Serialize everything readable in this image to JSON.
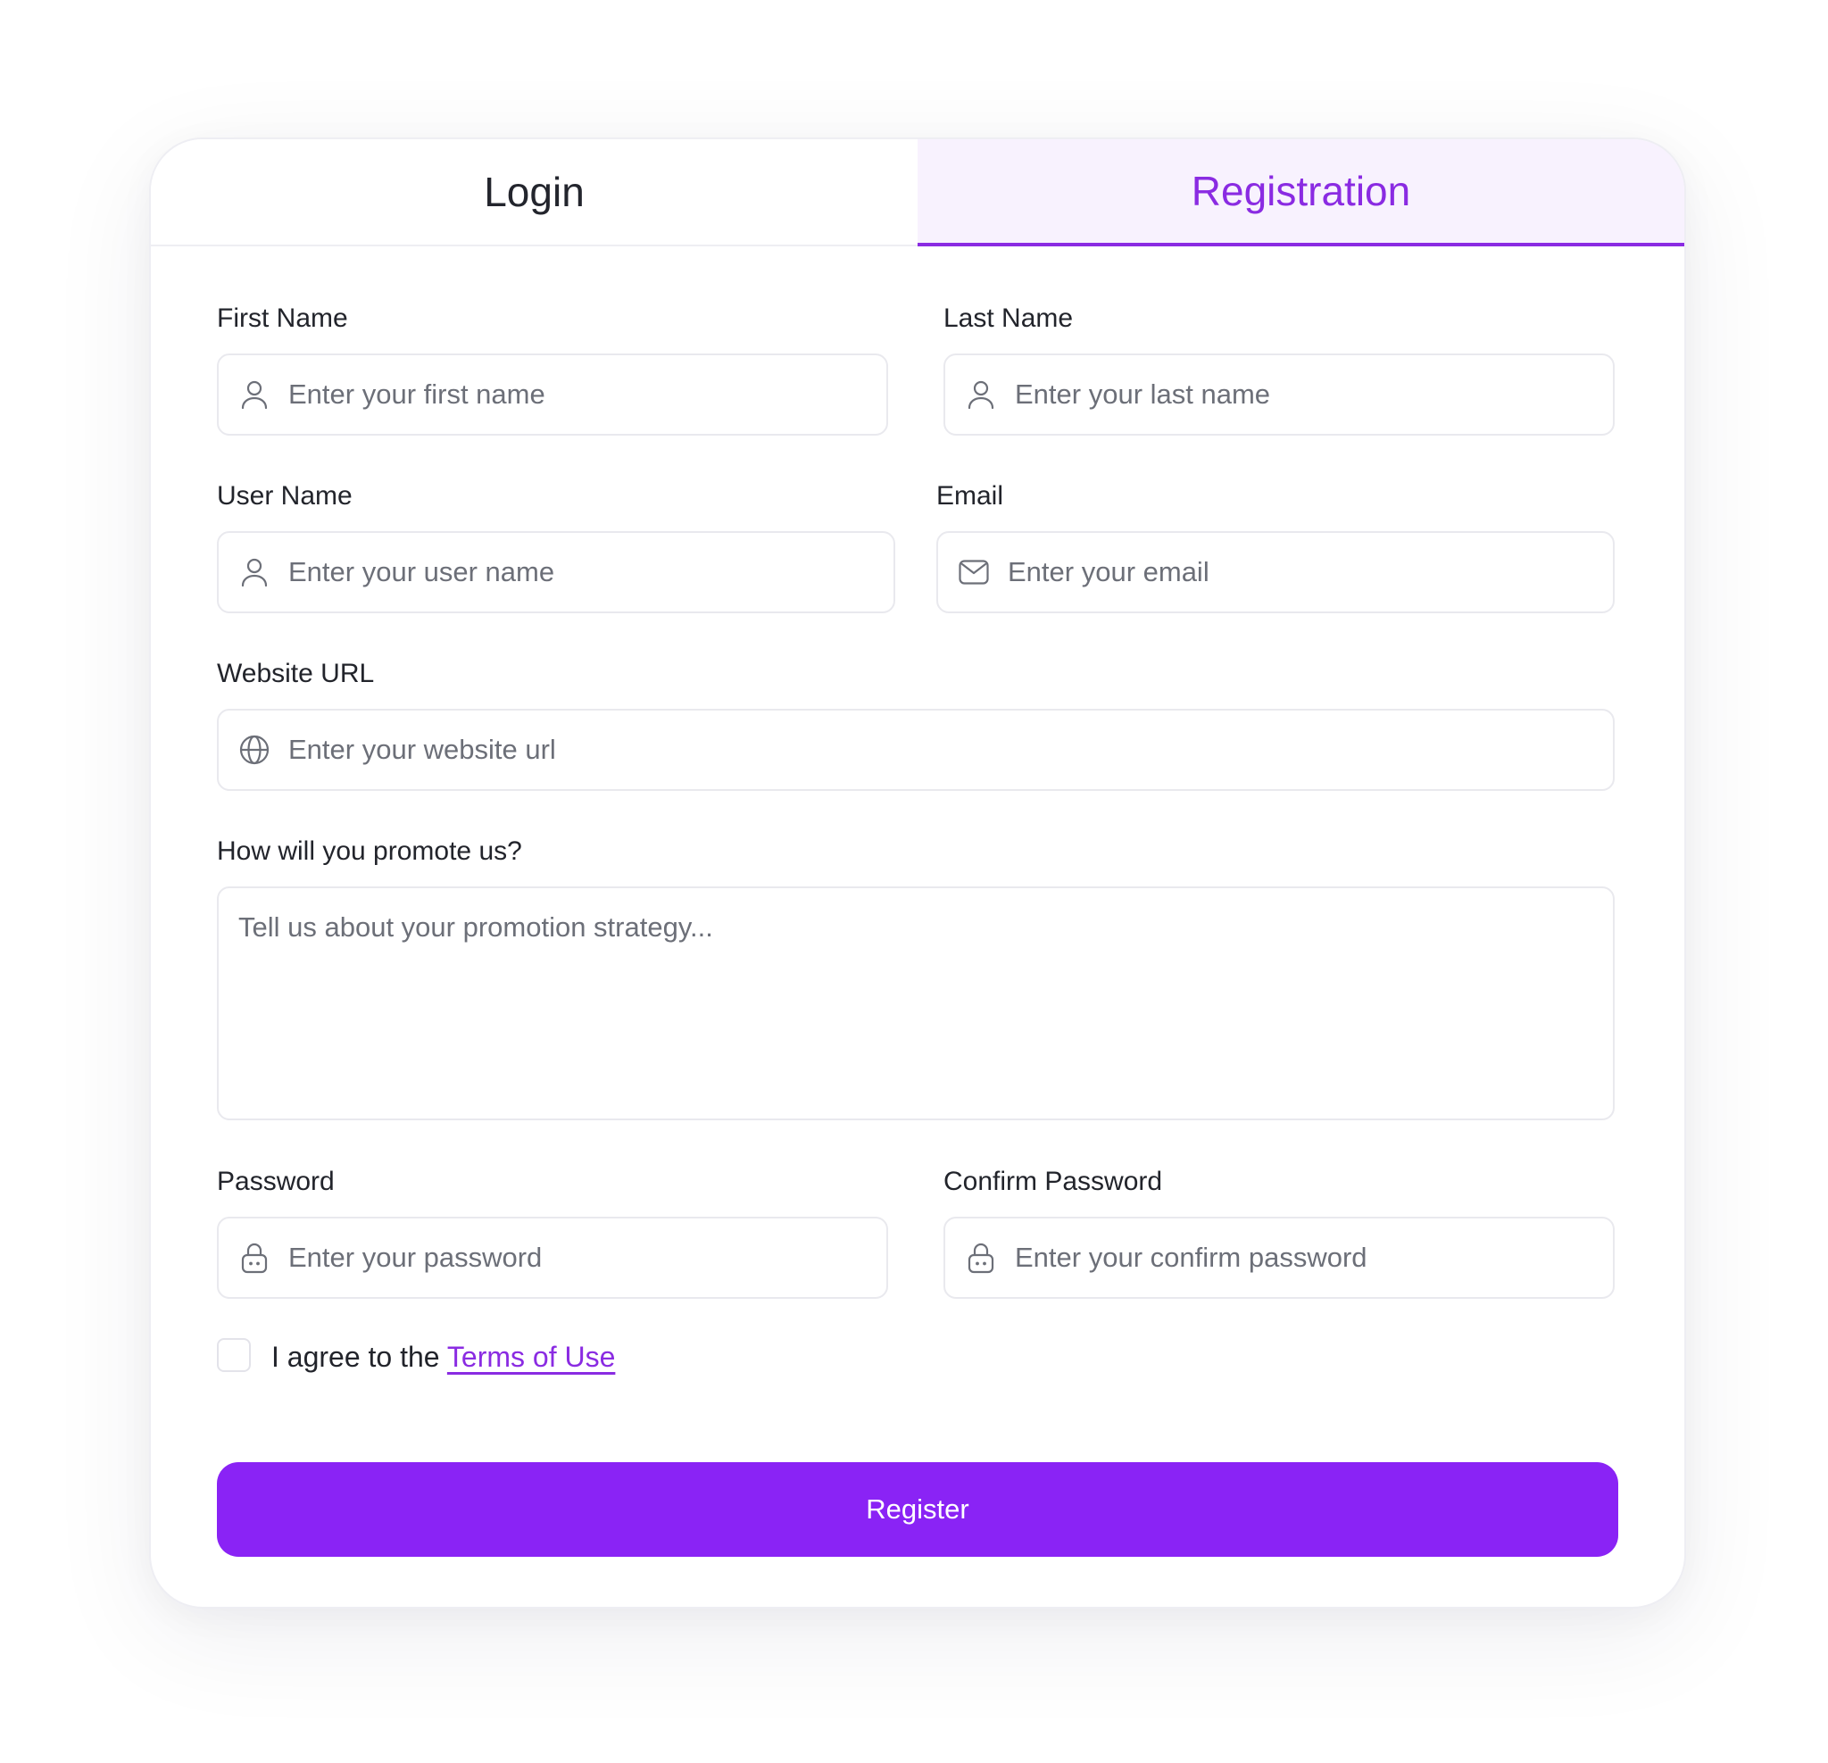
{
  "tabs": {
    "login": "Login",
    "registration": "Registration"
  },
  "form": {
    "first_name": {
      "label": "First Name",
      "placeholder": "Enter your first name"
    },
    "last_name": {
      "label": "Last Name",
      "placeholder": "Enter your last name"
    },
    "user_name": {
      "label": "User Name",
      "placeholder": "Enter your user name"
    },
    "email": {
      "label": "Email",
      "placeholder": "Enter your email"
    },
    "website": {
      "label": "Website URL",
      "placeholder": "Enter your website url"
    },
    "promotion": {
      "label": "How will you promote us?",
      "placeholder": "Tell us about your promotion strategy..."
    },
    "password": {
      "label": "Password",
      "placeholder": "Enter your password"
    },
    "confirm_password": {
      "label": "Confirm Password",
      "placeholder": "Enter your confirm password"
    },
    "terms": {
      "prefix": "I agree to the ",
      "link": "Terms of Use"
    },
    "submit": "Register"
  },
  "colors": {
    "accent": "#8a23f5",
    "active_tab_bg": "#f8f2fe",
    "border": "#e9e9ee",
    "placeholder": "#6c6f78"
  },
  "icons": {
    "first_name": "user-icon",
    "last_name": "user-icon",
    "user_name": "user-icon",
    "email": "mail-icon",
    "website": "globe-icon",
    "password": "lock-icon",
    "confirm_password": "lock-icon"
  }
}
